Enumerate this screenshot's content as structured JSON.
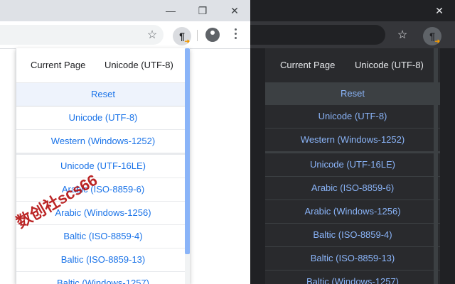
{
  "popup": {
    "header": {
      "current_page": "Current Page",
      "current_encoding": "Unicode (UTF-8)"
    },
    "reset_label": "Reset",
    "encodings": [
      "Unicode (UTF-8)",
      "Western (Windows-1252)",
      "Unicode (UTF-16LE)",
      "Arabic (ISO-8859-6)",
      "Arabic (Windows-1256)",
      "Baltic (ISO-8859-4)",
      "Baltic (ISO-8859-13)",
      "Baltic (Windows-1257)"
    ]
  },
  "watermark": "数创社scs66",
  "icons": {
    "minimize": "minimize-icon",
    "restore": "restore-icon",
    "close": "close-icon",
    "bookmark": "star-icon",
    "extension": "pilcrow-icon",
    "profile": "avatar-icon",
    "menu": "kebab-menu-icon"
  },
  "colors": {
    "accent_light": "#1a73e8",
    "accent_dark": "#8ab4f8"
  }
}
